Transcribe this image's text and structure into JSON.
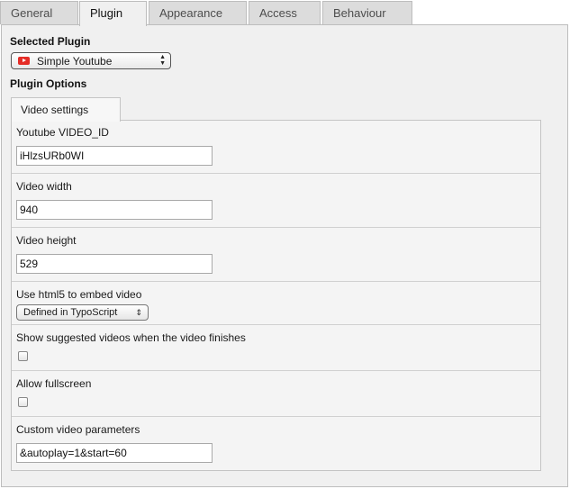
{
  "tabs": [
    "General",
    "Plugin",
    "Appearance",
    "Access",
    "Behaviour"
  ],
  "selected_plugin": {
    "heading": "Selected Plugin",
    "value": "Simple Youtube"
  },
  "plugin_options": {
    "heading": "Plugin Options",
    "subtab": "Video settings",
    "video_id": {
      "label": "Youtube VIDEO_ID",
      "value": "iHlzsURb0WI"
    },
    "video_width": {
      "label": "Video width",
      "value": "940"
    },
    "video_height": {
      "label": "Video height",
      "value": "529"
    },
    "html5": {
      "label": "Use html5 to embed video",
      "value": "Defined in TypoScript"
    },
    "suggested": {
      "label": "Show suggested videos when the video finishes",
      "checked": false
    },
    "fullscreen": {
      "label": "Allow fullscreen",
      "checked": false
    },
    "custom_params": {
      "label": "Custom video parameters",
      "value": "&autoplay=1&start=60"
    }
  }
}
